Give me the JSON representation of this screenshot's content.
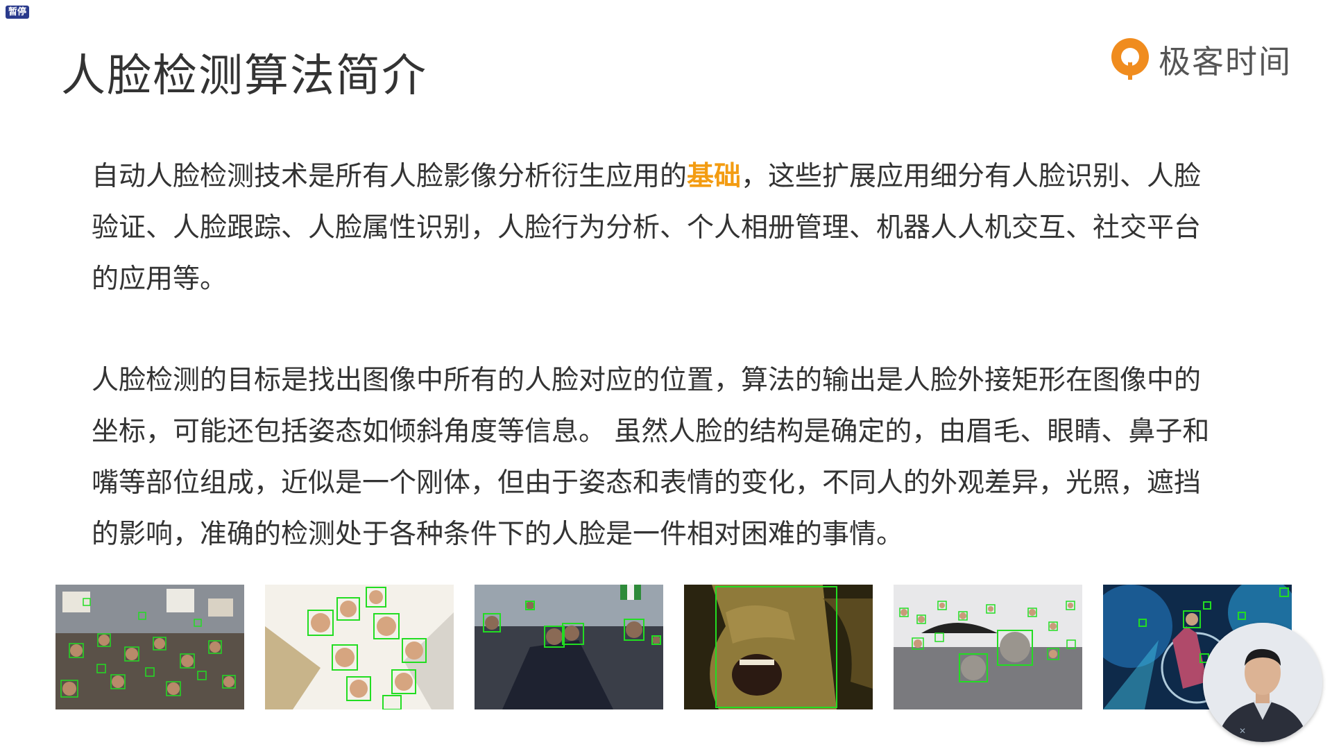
{
  "overlay": {
    "pause_label": "暂停"
  },
  "slide": {
    "title": "人脸检测算法简介",
    "logo_text": "极客时间",
    "paragraph1": {
      "before": "自动人脸检测技术是所有人脸影像分析衍生应用的",
      "highlight": "基础",
      "after": "，这些扩展应用细分有人脸识别、人脸验证、人脸跟踪、人脸属性识别，人脸行为分析、个人相册管理、机器人人机交互、社交平台的应用等。"
    },
    "paragraph2": "人脸检测的目标是找出图像中所有的人脸对应的位置，算法的输出是人脸外接矩形在图像中的坐标，可能还包括姿态如倾斜角度等信息。 虽然人脸的结构是确定的，由眉毛、眼睛、鼻子和嘴等部位组成，近似是一个刚体，但由于姿态和表情的变化，不同人的外观差异，光照，遮挡的影响，准确的检测处于各种条件下的人脸是一件相对困难的事情。"
  },
  "colors": {
    "highlight": "#f39c12",
    "detection_box": "#22dd22",
    "logo_orange": "#f08c1e",
    "title_text": "#333333"
  },
  "icons": {
    "logo": "geektime-logo-icon",
    "pause": "pause-badge"
  },
  "thumbnails": [
    {
      "name": "crowd-protest-image"
    },
    {
      "name": "group-looking-down-image"
    },
    {
      "name": "celebration-crowd-image"
    },
    {
      "name": "screaming-face-closeup-image"
    },
    {
      "name": "mud-festival-crowd-image"
    },
    {
      "name": "concert-stage-image"
    }
  ]
}
